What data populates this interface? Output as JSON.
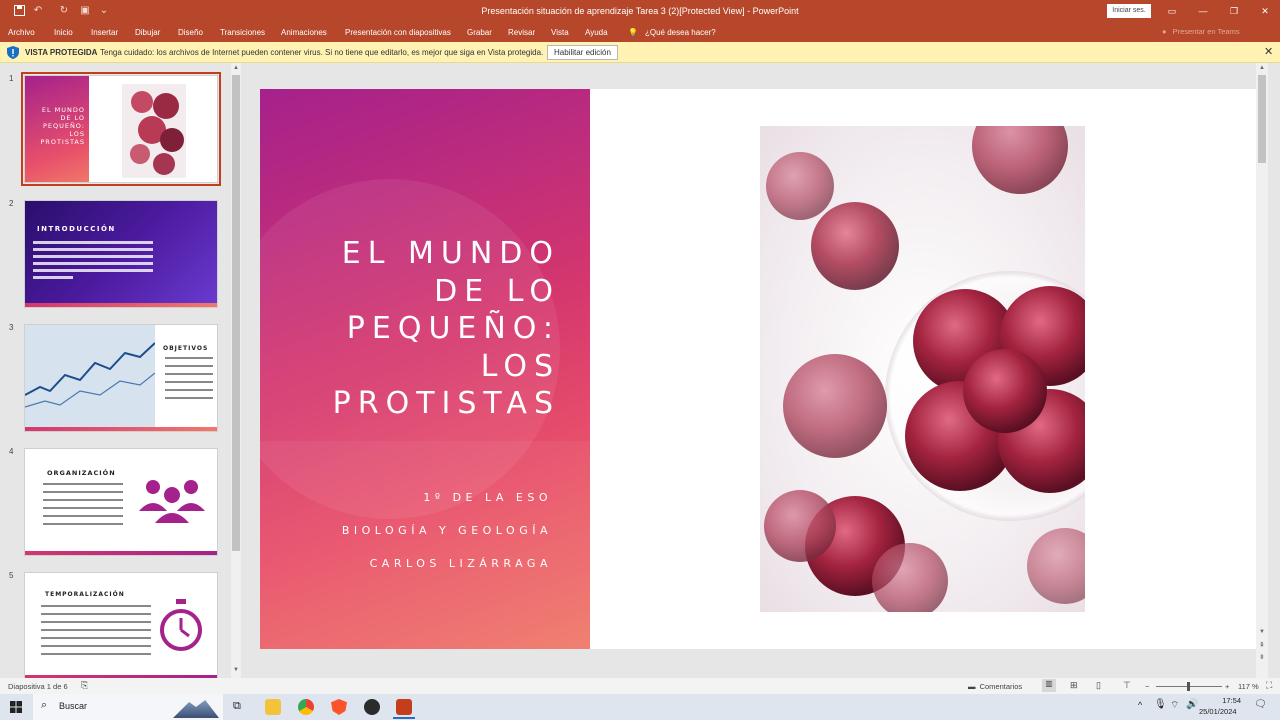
{
  "title_bar": {
    "title": "Presentación situación de aprendizaje Tarea 3 (2)[Protected View] - PowerPoint",
    "sign_in": "Iniciar ses."
  },
  "menu": {
    "items": [
      "Archivo",
      "Inicio",
      "Insertar",
      "Dibujar",
      "Diseño",
      "Transiciones",
      "Animaciones",
      "Presentación con diapositivas",
      "Grabar",
      "Revisar",
      "Vista",
      "Ayuda"
    ],
    "tell_me": "¿Qué desea hacer?",
    "present_in_teams": "Presentar en Teams"
  },
  "protected_bar": {
    "label": "VISTA PROTEGIDA",
    "message": "Tenga cuidado: los archivos de Internet pueden contener virus. Si no tiene que editarlo, es mejor que siga en Vista protegida.",
    "enable_button": "Habilitar edición"
  },
  "thumbnails": [
    {
      "number": "1",
      "title": "EL MUNDO DE LO PEQUEÑO: LOS PROTISTAS"
    },
    {
      "number": "2",
      "title": "INTRODUCCIÓN"
    },
    {
      "number": "3",
      "title": "OBJETIVOS"
    },
    {
      "number": "4",
      "title": "ORGANIZACIÓN"
    },
    {
      "number": "5",
      "title": "TEMPORALIZACIÓN"
    }
  ],
  "slide": {
    "title": "EL MUNDO\nDE LO\nPEQUEÑO:\nLOS\nPROTISTAS",
    "subtitle_1": "1º DE LA ESO",
    "subtitle_2": "BIOLOGÍA Y GEOLOGÍA",
    "subtitle_3": "CARLOS LIZÁRRAGA"
  },
  "status_bar": {
    "slide_counter": "Diapositiva 1 de 6",
    "comments": "Comentarios",
    "zoom": "117 %"
  },
  "taskbar": {
    "search": "Buscar",
    "time": "17:54",
    "date": "25/01/2024"
  },
  "colors": {
    "accent": "#b7472a",
    "slide_gradient_top": "#a5218c",
    "slide_gradient_bottom": "#f07a6a",
    "protected_bar": "#fff2b3"
  }
}
